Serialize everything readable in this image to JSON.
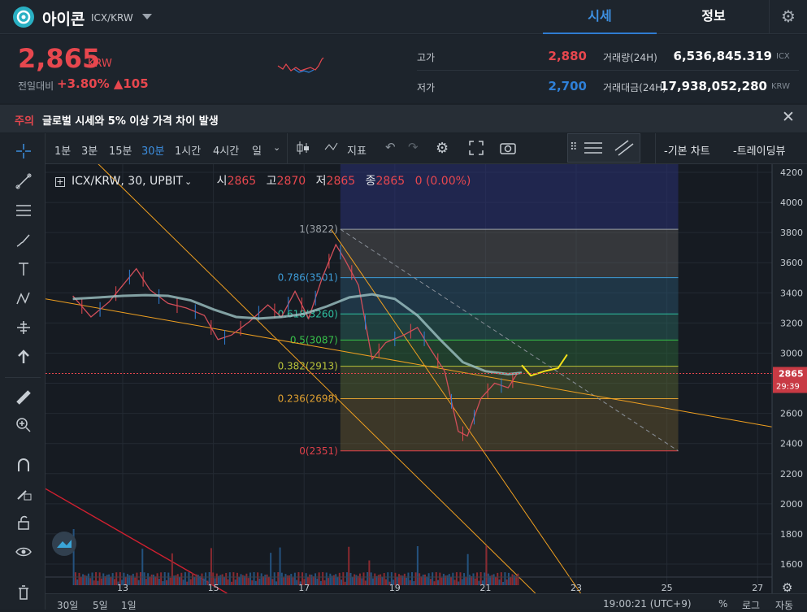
{
  "header": {
    "coin_name": "아이콘",
    "pair": "ICX/KRW",
    "tabs": [
      "시세",
      "정보"
    ]
  },
  "ticker": {
    "price": "2,865",
    "unit": "KRW",
    "change_label": "전일대비",
    "change_value": "+3.80% ▲105",
    "high_label": "고가",
    "high_value": "2,880",
    "low_label": "저가",
    "low_value": "2,700",
    "volume_label": "거래량(24H)",
    "volume_value": "6,536,845.319",
    "volume_unit": "ICX",
    "amount_label": "거래대금(24H)",
    "amount_value": "17,938,052,280",
    "amount_unit": "KRW"
  },
  "notice": {
    "warning": "주의",
    "text": "글로벌 시세와 5% 이상 가격 차이 발생"
  },
  "toolbar": {
    "intervals": [
      "1분",
      "3분",
      "15분",
      "30분",
      "1시간",
      "4시간",
      "일"
    ],
    "active_interval": "30분",
    "indicators_label": "지표",
    "basic_chart": "-기본 차트",
    "trading_view": "-트레이딩뷰"
  },
  "legend": {
    "symbol": "ICX/KRW, 30, UPBIT",
    "open_label": "시",
    "open": "2865",
    "high_label": "고",
    "high": "2870",
    "low_label": "저",
    "low": "2865",
    "close_label": "종",
    "close": "2865",
    "change": "0 (0.00%)"
  },
  "bottom": {
    "ranges": [
      "30일",
      "5일",
      "1일"
    ],
    "time": "19:00:21 (UTC+9)",
    "pct": "%",
    "log": "로그",
    "auto": "자동"
  },
  "colors": {
    "up": "#e7474e",
    "down": "#2f80d8",
    "accent": "#2f7cd2"
  },
  "chart_data": {
    "type": "line",
    "title": "ICX/KRW, 30, UPBIT",
    "x_ticks": [
      "13",
      "15",
      "17",
      "19",
      "21",
      "23",
      "25",
      "27"
    ],
    "y_ticks": [
      4200,
      4000,
      3800,
      3600,
      3400,
      3200,
      3000,
      2800,
      2600,
      2400,
      2200,
      2000,
      1800,
      1600
    ],
    "ylim": [
      1600,
      4200
    ],
    "current_price_label": "2865",
    "countdown_label": "29:39",
    "fibonacci_levels": [
      {
        "ratio": "1",
        "price": 3822,
        "label": "1(3822)"
      },
      {
        "ratio": "0.786",
        "price": 3501,
        "label": "0.786(3501)"
      },
      {
        "ratio": "0.618",
        "price": 3260,
        "label": "0.618(3260)"
      },
      {
        "ratio": "0.5",
        "price": 3087,
        "label": "0.5(3087)"
      },
      {
        "ratio": "0.382",
        "price": 2913,
        "label": "0.382(2913)"
      },
      {
        "ratio": "0.236",
        "price": 2698,
        "label": "0.236(2698)"
      },
      {
        "ratio": "0",
        "price": 2351,
        "label": "0(2351)"
      }
    ],
    "price_series": {
      "x": [
        11.9,
        12.3,
        12.7,
        13.0,
        13.3,
        13.6,
        14.0,
        14.4,
        14.8,
        15.1,
        15.4,
        15.8,
        16.2,
        16.5,
        16.8,
        17.1,
        17.4,
        17.7,
        17.9,
        18.2,
        18.5,
        18.8,
        19.2,
        19.5,
        19.8,
        20.1,
        20.4,
        20.6,
        20.9,
        21.2,
        21.5,
        21.7
      ],
      "y": [
        3380,
        3240,
        3340,
        3450,
        3560,
        3420,
        3330,
        3300,
        3250,
        3090,
        3120,
        3210,
        3320,
        3240,
        3410,
        3230,
        3500,
        3720,
        3620,
        3450,
        2960,
        3070,
        3120,
        3170,
        3020,
        2880,
        2480,
        2450,
        2700,
        2800,
        2770,
        2865
      ]
    },
    "ma_series": {
      "x": [
        11.9,
        12.5,
        13.0,
        13.5,
        14.0,
        14.5,
        15.0,
        15.5,
        16.0,
        16.5,
        17.0,
        17.5,
        18.0,
        18.5,
        19.0,
        19.5,
        20.0,
        20.5,
        21.0,
        21.5,
        21.8
      ],
      "y": [
        3360,
        3370,
        3380,
        3385,
        3380,
        3350,
        3290,
        3240,
        3230,
        3240,
        3260,
        3310,
        3370,
        3390,
        3360,
        3250,
        3090,
        2940,
        2880,
        2860,
        2870
      ]
    },
    "projection": {
      "x": [
        21.8,
        22.0,
        22.3,
        22.6,
        22.8
      ],
      "y": [
        2920,
        2850,
        2880,
        2900,
        2990
      ]
    }
  }
}
